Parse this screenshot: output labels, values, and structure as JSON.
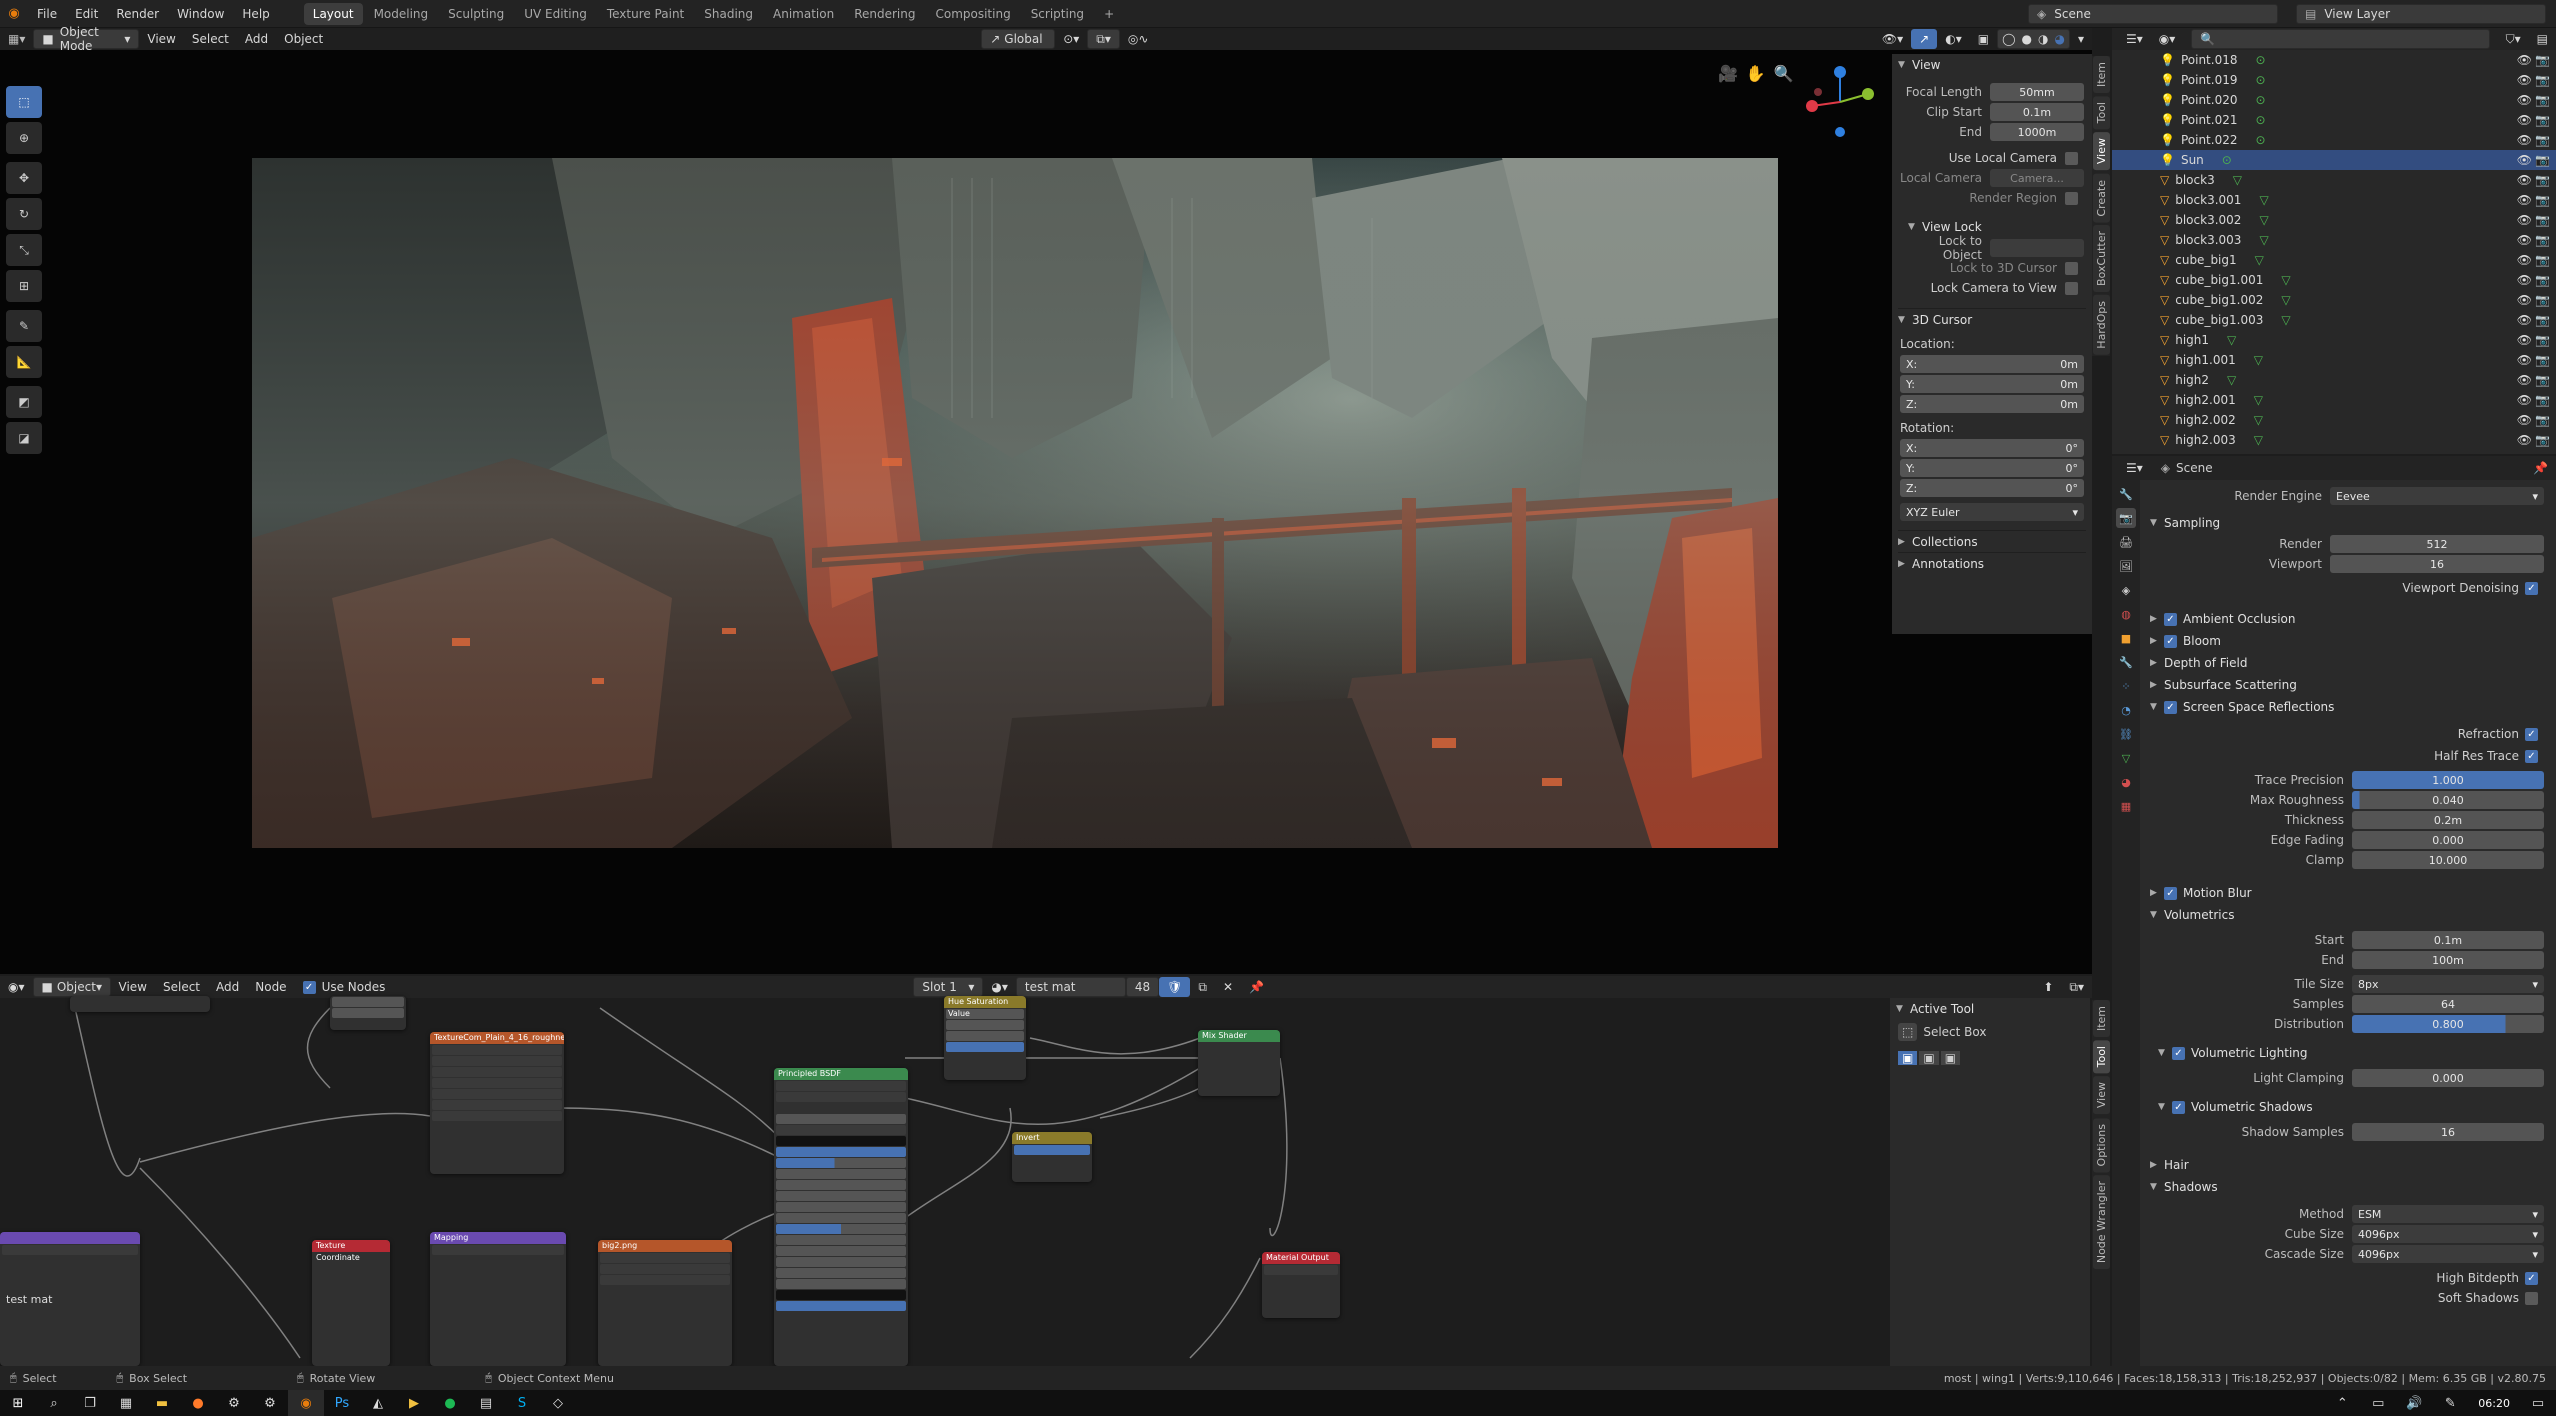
{
  "menus": [
    "File",
    "Edit",
    "Render",
    "Window",
    "Help"
  ],
  "workspaces": [
    "Layout",
    "Modeling",
    "Sculpting",
    "UV Editing",
    "Texture Paint",
    "Shading",
    "Animation",
    "Rendering",
    "Compositing",
    "Scripting",
    "+"
  ],
  "scene_name": "Scene",
  "view_layer": "View Layer",
  "viewport_header": {
    "mode": "Object Mode",
    "menus": [
      "View",
      "Select",
      "Add",
      "Object"
    ],
    "orientation": "Global"
  },
  "npanel": {
    "view_title": "View",
    "focal_length_label": "Focal Length",
    "focal_length": "50mm",
    "clip_start_label": "Clip Start",
    "clip_start": "0.1m",
    "end_label": "End",
    "clip_end": "1000m",
    "use_local_camera": "Use Local Camera",
    "local_camera_label": "Local Camera",
    "local_camera": "Camera...",
    "render_region": "Render Region",
    "view_lock_title": "View Lock",
    "lock_to_object": "Lock to Object",
    "lock_3d_cursor": "Lock to 3D Cursor",
    "lock_camera": "Lock Camera to View",
    "cursor_title": "3D Cursor",
    "location_label": "Location:",
    "rotation_label": "Rotation:",
    "loc": [
      {
        "axis": "X:",
        "val": "0m"
      },
      {
        "axis": "Y:",
        "val": "0m"
      },
      {
        "axis": "Z:",
        "val": "0m"
      }
    ],
    "rot": [
      {
        "axis": "X:",
        "val": "0°"
      },
      {
        "axis": "Y:",
        "val": "0°"
      },
      {
        "axis": "Z:",
        "val": "0°"
      }
    ],
    "rot_mode": "XYZ Euler",
    "collections": "Collections",
    "annotations": "Annotations"
  },
  "sidebar_tabs": [
    "Item",
    "Tool",
    "View",
    "Create",
    "BoxCutter",
    "HardOps"
  ],
  "outliner": [
    {
      "name": "Point.018",
      "type": "light"
    },
    {
      "name": "Point.019",
      "type": "light"
    },
    {
      "name": "Point.020",
      "type": "light"
    },
    {
      "name": "Point.021",
      "type": "light"
    },
    {
      "name": "Point.022",
      "type": "light"
    },
    {
      "name": "Sun",
      "type": "sun",
      "selected": true
    },
    {
      "name": "block3",
      "type": "mesh"
    },
    {
      "name": "block3.001",
      "type": "mesh"
    },
    {
      "name": "block3.002",
      "type": "mesh"
    },
    {
      "name": "block3.003",
      "type": "mesh"
    },
    {
      "name": "cube_big1",
      "type": "mesh"
    },
    {
      "name": "cube_big1.001",
      "type": "mesh"
    },
    {
      "name": "cube_big1.002",
      "type": "mesh"
    },
    {
      "name": "cube_big1.003",
      "type": "mesh"
    },
    {
      "name": "high1",
      "type": "mesh"
    },
    {
      "name": "high1.001",
      "type": "mesh"
    },
    {
      "name": "high2",
      "type": "mesh"
    },
    {
      "name": "high2.001",
      "type": "mesh"
    },
    {
      "name": "high2.002",
      "type": "mesh"
    },
    {
      "name": "high2.003",
      "type": "mesh"
    }
  ],
  "props": {
    "scene": "Scene",
    "render_engine_label": "Render Engine",
    "render_engine": "Eevee",
    "sampling": "Sampling",
    "render_label": "Render",
    "render_samples": "512",
    "viewport_label": "Viewport",
    "viewport_samples": "16",
    "viewport_denoising": "Viewport Denoising",
    "ambient_occlusion": "Ambient Occlusion",
    "bloom": "Bloom",
    "depth_of_field": "Depth of Field",
    "subsurface": "Subsurface Scattering",
    "ssr": "Screen Space Reflections",
    "refraction": "Refraction",
    "half_res": "Half Res Trace",
    "trace_precision_label": "Trace Precision",
    "trace_precision": "1.000",
    "max_roughness_label": "Max Roughness",
    "max_roughness": "0.040",
    "thickness_label": "Thickness",
    "thickness": "0.2m",
    "edge_fading_label": "Edge Fading",
    "edge_fading": "0.000",
    "clamp_label": "Clamp",
    "clamp": "10.000",
    "motion_blur": "Motion Blur",
    "volumetrics": "Volumetrics",
    "start_label": "Start",
    "start": "0.1m",
    "end_label": "End",
    "end": "100m",
    "tile_size_label": "Tile Size",
    "tile_size": "8px",
    "samples_label": "Samples",
    "samples": "64",
    "distribution_label": "Distribution",
    "distribution": "0.800",
    "vol_lighting": "Volumetric Lighting",
    "light_clamping_label": "Light Clamping",
    "light_clamping": "0.000",
    "vol_shadows": "Volumetric Shadows",
    "shadow_samples_label": "Shadow Samples",
    "shadow_samples": "16",
    "hair": "Hair",
    "shadows": "Shadows",
    "method_label": "Method",
    "method": "ESM",
    "cube_size_label": "Cube Size",
    "cube_size": "4096px",
    "cascade_size_label": "Cascade Size",
    "cascade_size": "4096px",
    "high_bitdepth": "High Bitdepth",
    "soft_shadows": "Soft Shadows"
  },
  "node_header": {
    "type": "Object",
    "menus": [
      "View",
      "Select",
      "Add",
      "Node"
    ],
    "use_nodes": "Use Nodes",
    "slot": "Slot 1",
    "material": "test mat",
    "users": "48"
  },
  "node_sidebar": {
    "active_tool": "Active Tool",
    "select_box": "Select Box",
    "tabs": [
      "Item",
      "Tool",
      "View",
      "Options",
      "Node Wrangler"
    ]
  },
  "nodes": {
    "image1": "TextureCom_Plain_4_16_roughness.tif",
    "image2": "big2.png",
    "principled": "Principled BSDF",
    "hsv": "Hue Saturation Value",
    "invert": "Invert",
    "mix": "Mix Shader",
    "output": "Material Output",
    "texcoord": "Texture Coordinate",
    "mapping": "Mapping",
    "mat_label": "test mat"
  },
  "statusbar": {
    "select": "Select",
    "box_select": "Box Select",
    "rotate_view": "Rotate View",
    "context_menu": "Object Context Menu",
    "stats": "most | wing1 | Verts:9,110,646 | Faces:18,158,313 | Tris:18,252,937 | Objects:0/82 | Mem: 6.35 GB | v2.80.75"
  },
  "taskbar": {
    "time": "06:20"
  },
  "colors": {
    "accent": "#4772b3",
    "selected_row": "#334d80"
  }
}
